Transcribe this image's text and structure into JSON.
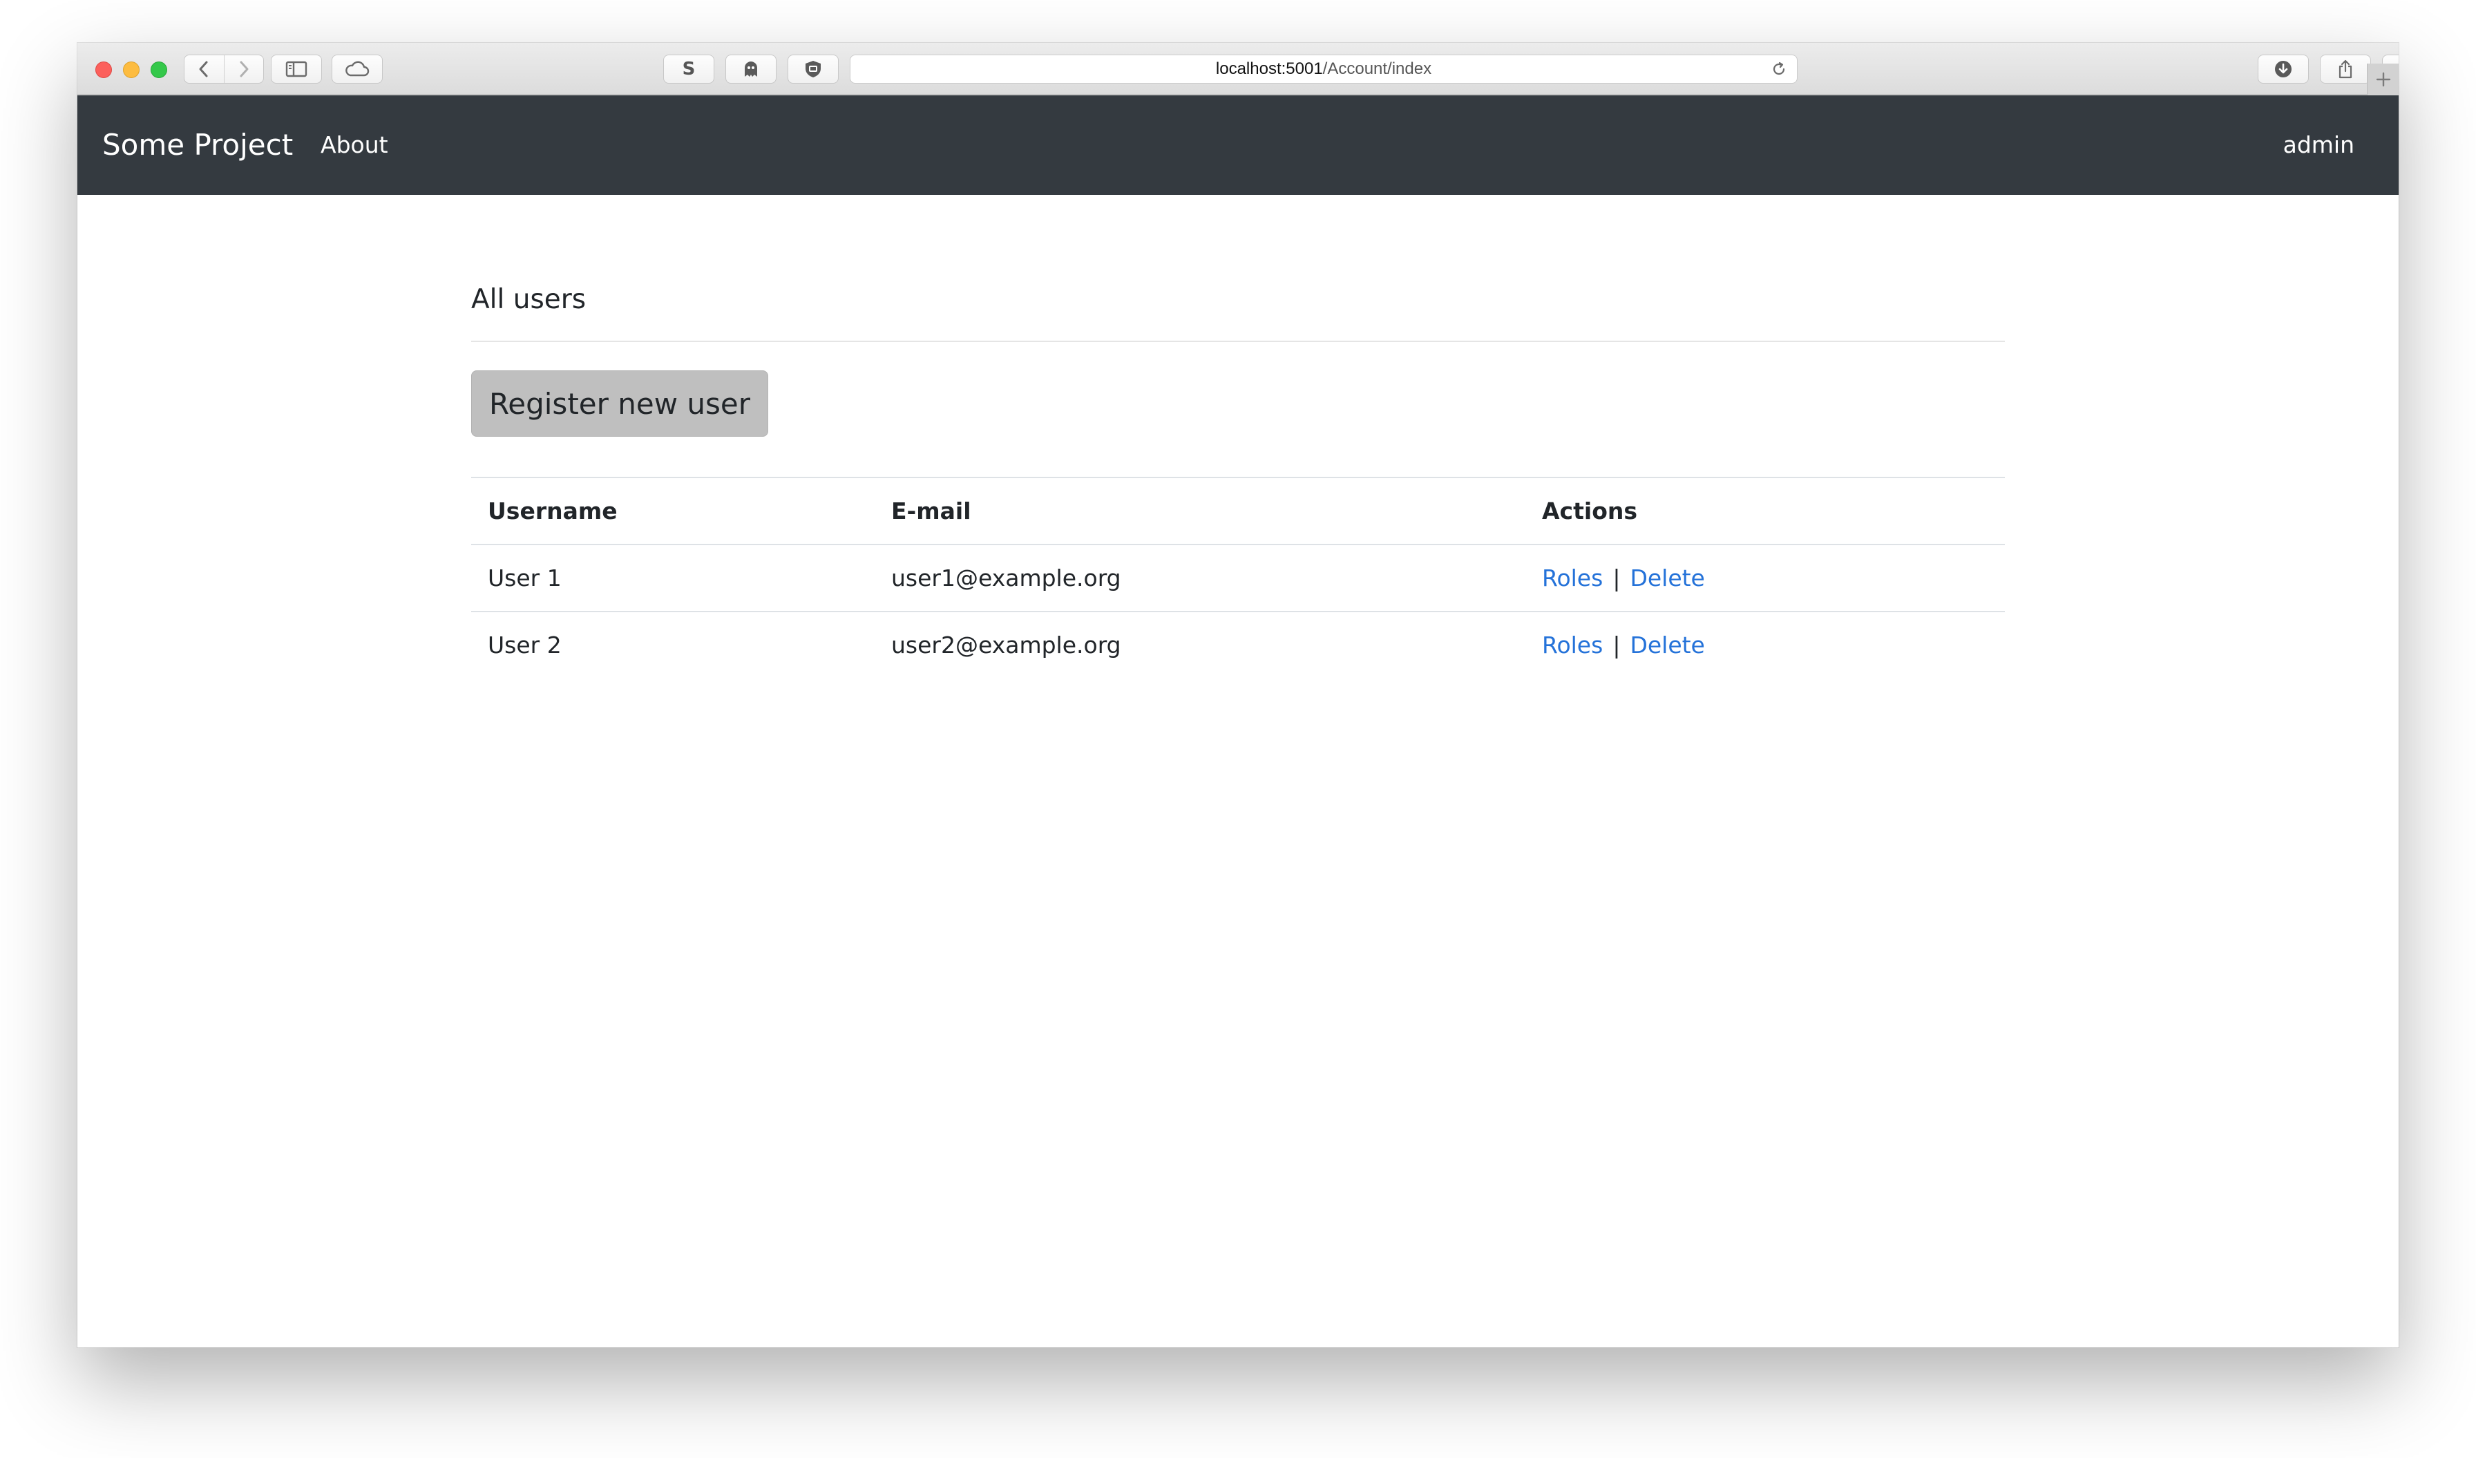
{
  "browser": {
    "url_host": "localhost:5001",
    "url_path": "/Account/index",
    "toolbar_icons": [
      "back-icon",
      "forward-icon",
      "sidebar-icon",
      "icloud-tabs-icon",
      "s-extension-icon",
      "ghostery-icon",
      "privacy-shield-icon",
      "reload-icon",
      "downloads-icon",
      "share-icon",
      "tabs-overview-icon",
      "new-tab-icon"
    ],
    "s_extension_label": "S"
  },
  "navbar": {
    "brand": "Some Project",
    "about": "About",
    "user": "admin",
    "background": "#343a40"
  },
  "page": {
    "title": "All users",
    "register_button": "Register new user"
  },
  "table": {
    "headers": {
      "username": "Username",
      "email": "E-mail",
      "actions": "Actions"
    },
    "rows": [
      {
        "username": "User 1",
        "email": "user1@example.org",
        "roles": "Roles",
        "separator": "|",
        "delete": "Delete"
      },
      {
        "username": "User 2",
        "email": "user2@example.org",
        "roles": "Roles",
        "separator": "|",
        "delete": "Delete"
      }
    ]
  },
  "colors": {
    "link": "#2472d9",
    "button_bg": "#bfbfbf"
  }
}
